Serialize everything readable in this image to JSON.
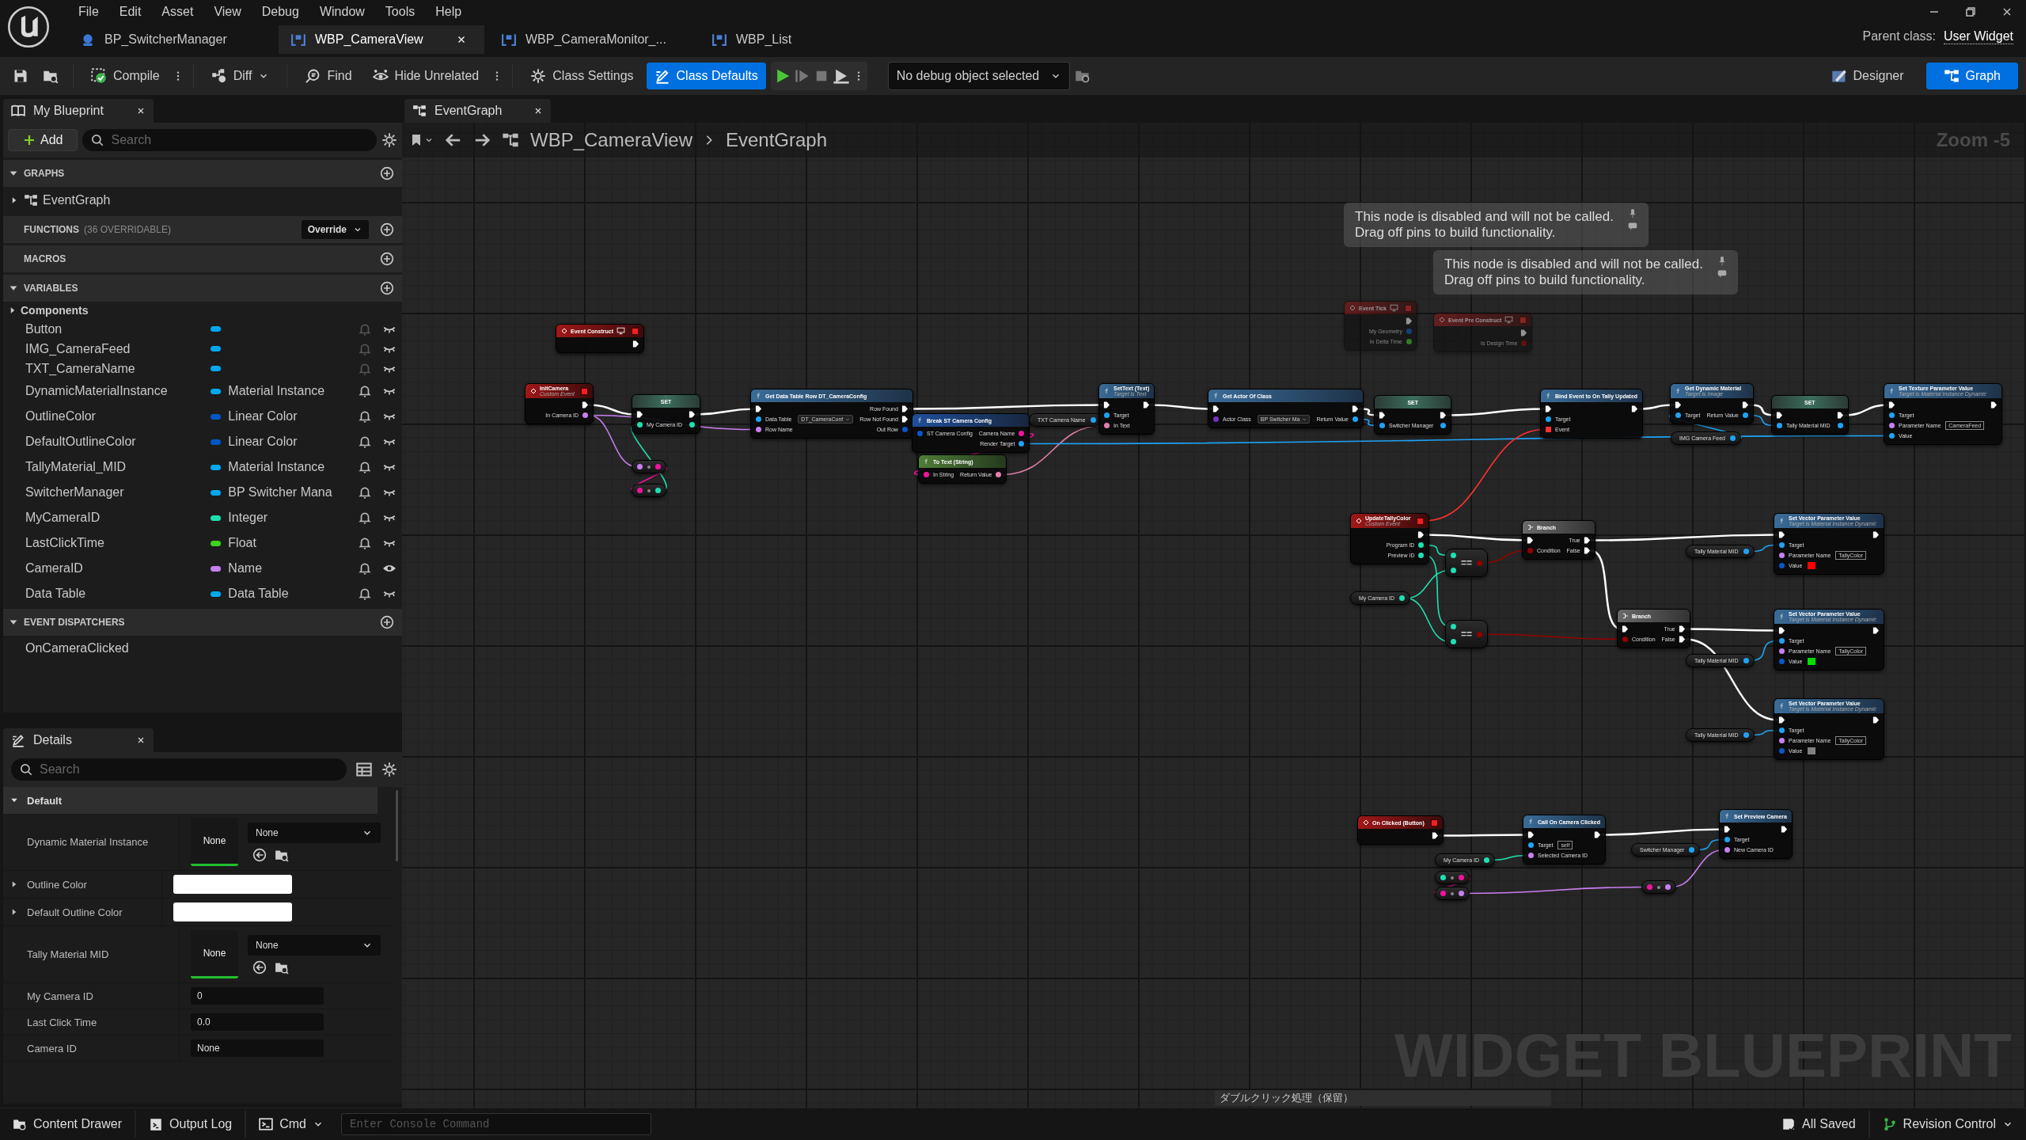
{
  "menu_bar": {
    "menus": [
      "File",
      "Edit",
      "Asset",
      "View",
      "Debug",
      "Window",
      "Tools",
      "Help"
    ]
  },
  "document_tabs": [
    {
      "label": "BP_SwitcherManager",
      "kind": "actor",
      "selected": false
    },
    {
      "label": "WBP_CameraView",
      "kind": "widget",
      "selected": true
    },
    {
      "label": "WBP_CameraMonitor_...",
      "kind": "widget",
      "selected": false
    },
    {
      "label": "WBP_List",
      "kind": "widget",
      "selected": false
    }
  ],
  "parent_class": {
    "label": "Parent class:",
    "value": "User Widget"
  },
  "toolbar": {
    "compile": "Compile",
    "diff": "Diff",
    "find": "Find",
    "hide_unrelated": "Hide Unrelated",
    "class_settings": "Class Settings",
    "class_defaults": {
      "label": "Class Defaults",
      "selected": true
    },
    "debug_object": "No debug object selected",
    "modes": [
      {
        "label": "Designer",
        "kind": "designer",
        "selected": false
      },
      {
        "label": "Graph",
        "kind": "graph",
        "selected": true
      }
    ]
  },
  "my_blueprint": {
    "tab": "My Blueprint",
    "add": "Add",
    "search_placeholder": "Search",
    "graphs": {
      "title": "GRAPHS",
      "expanded": true,
      "items": [
        {
          "label": "EventGraph",
          "expanded": false
        }
      ]
    },
    "functions": {
      "title": "FUNCTIONS",
      "note": "(36 OVERRIDABLE)",
      "override": "Override"
    },
    "macros": {
      "title": "MACROS"
    },
    "variables": {
      "title": "VARIABLES",
      "expanded": true,
      "category": {
        "label": "Components",
        "expanded": false
      },
      "items": [
        {
          "name": "Button",
          "color": "#00a8f0",
          "exposed": false
        },
        {
          "name": "IMG_CameraFeed",
          "color": "#00a8f0",
          "exposed": false
        },
        {
          "name": "TXT_CameraName",
          "color": "#00a8f0",
          "exposed": false
        },
        {
          "name": "DynamicMaterialInstance",
          "type": "Material Instance",
          "color": "#00a8f0",
          "exposed": false
        },
        {
          "name": "OutlineColor",
          "type": "Linear Color",
          "color": "#0058c8",
          "exposed": false
        },
        {
          "name": "DefaultOutlineColor",
          "type": "Linear Color",
          "color": "#0058c8",
          "exposed": false
        },
        {
          "name": "TallyMaterial_MID",
          "type": "Material Instance",
          "color": "#00a8f0",
          "exposed": false
        },
        {
          "name": "SwitcherManager",
          "type": "BP Switcher Mana",
          "color": "#00a8f0",
          "exposed": false
        },
        {
          "name": "MyCameraID",
          "type": "Integer",
          "color": "#1ee0b0",
          "exposed": false
        },
        {
          "name": "LastClickTime",
          "type": "Float",
          "color": "#3cd41e",
          "exposed": false
        },
        {
          "name": "CameraID",
          "type": "Name",
          "color": "#c880f0",
          "exposed": true
        },
        {
          "name": "Data Table",
          "type": "Data Table",
          "color": "#00a8f0",
          "exposed": false
        }
      ]
    },
    "event_dispatchers": {
      "title": "EVENT DISPATCHERS",
      "expanded": true,
      "items": [
        {
          "label": "OnCameraClicked"
        }
      ]
    }
  },
  "details": {
    "tab": "Details",
    "search_placeholder": "Search",
    "category": {
      "label": "Default",
      "expanded": true
    },
    "rows": [
      {
        "kind": "object",
        "label": "Dynamic Material Instance",
        "thumbnail": "None",
        "value": "None"
      },
      {
        "kind": "color",
        "label": "Outline Color",
        "expanded": false
      },
      {
        "kind": "color",
        "label": "Default Outline Color",
        "expanded": false
      },
      {
        "kind": "object",
        "label": "Tally Material MID",
        "thumbnail": "None",
        "value": "None"
      },
      {
        "kind": "field",
        "label": "My Camera ID",
        "value": "0"
      },
      {
        "kind": "field",
        "label": "Last Click Time",
        "value": "0.0"
      },
      {
        "kind": "field",
        "label": "Camera ID",
        "value": "None"
      }
    ]
  },
  "graph": {
    "tab": "EventGraph",
    "breadcrumb": [
      "WBP_CameraView",
      "EventGraph"
    ],
    "zoom": "Zoom -5",
    "watermark": "WIDGET BLUEPRINT",
    "comment": "ダブルクリック処理（保留）",
    "disabled_notes": [
      {
        "text": "This node is disabled and will not be called.\nDrag off pins to build functionality."
      },
      {
        "text": "This node is disabled and will not be called.\nDrag off pins to build functionality."
      }
    ],
    "nodes": [
      {
        "kind": "event",
        "title": "Event Construct",
        "override": true,
        "disabled": false,
        "outputs": [
          {
            "kind": "exec"
          }
        ]
      },
      {
        "kind": "event",
        "title": "InitCamera",
        "subtitle": "Custom Event",
        "override": false,
        "disabled": false,
        "outputs": [
          {
            "kind": "exec"
          },
          {
            "label": "In Camera ID",
            "kind": "name"
          }
        ]
      },
      {
        "kind": "set",
        "title": "SET",
        "disabled": false,
        "inputs": [
          {
            "kind": "exec"
          },
          {
            "label": "My Camera ID",
            "kind": "int"
          }
        ],
        "outputs": [
          {
            "kind": "exec"
          },
          {
            "kind": "int"
          }
        ]
      },
      {
        "kind": "function",
        "title": "Get Data Table Row DT_CameraConfig",
        "disabled": false,
        "inputs": [
          {
            "kind": "exec"
          },
          {
            "label": "Data Table",
            "kind": "object",
            "dropdown": "DT_CameraConf"
          },
          {
            "label": "Row Name",
            "kind": "name"
          }
        ],
        "outputs": [
          {
            "label": "Row Found",
            "kind": "exec"
          },
          {
            "label": "Row Not Found",
            "kind": "exec"
          },
          {
            "label": "Out Row",
            "kind": "struct"
          }
        ]
      },
      {
        "kind": "struct",
        "title": "Break ST Camera Config",
        "disabled": false,
        "inputs": [
          {
            "label": "ST Camera Config",
            "kind": "struct"
          }
        ],
        "outputs": [
          {
            "label": "Camera Name",
            "kind": "string"
          },
          {
            "label": "Render Target",
            "kind": "object"
          }
        ]
      },
      {
        "kind": "pure",
        "title": "To Text (String)",
        "disabled": false,
        "inputs": [
          {
            "label": "In String",
            "kind": "string"
          }
        ],
        "outputs": [
          {
            "label": "Return Value",
            "kind": "text"
          }
        ]
      },
      {
        "kind": "variable",
        "title": "TXT Camera Name",
        "disabled": false,
        "outputs": [
          {
            "kind": "object"
          }
        ]
      },
      {
        "kind": "function",
        "title": "SetText (Text)",
        "subtitle": "Target is Text",
        "disabled": false,
        "inputs": [
          {
            "kind": "exec"
          },
          {
            "label": "Target",
            "kind": "object"
          },
          {
            "label": "In Text",
            "kind": "text"
          }
        ],
        "outputs": [
          {
            "kind": "exec"
          }
        ]
      },
      {
        "kind": "function",
        "title": "Get Actor Of Class",
        "disabled": false,
        "inputs": [
          {
            "kind": "exec"
          },
          {
            "label": "Actor Class",
            "kind": "class",
            "dropdown": "BP Switcher Ma"
          }
        ],
        "outputs": [
          {
            "kind": "exec"
          },
          {
            "label": "Return Value",
            "kind": "object"
          }
        ]
      },
      {
        "kind": "compact",
        "disabled": false,
        "inputs": [
          {
            "kind": "name"
          }
        ],
        "outputs": [
          {
            "kind": "string"
          }
        ]
      },
      {
        "kind": "compact",
        "disabled": false,
        "inputs": [
          {
            "kind": "string"
          }
        ],
        "outputs": [
          {
            "kind": "int"
          }
        ]
      },
      {
        "kind": "event",
        "title": "Event Tick",
        "override": true,
        "disabled": true,
        "outputs": [
          {
            "kind": "exec"
          },
          {
            "label": "My Geometry",
            "kind": "struct"
          },
          {
            "label": "In Delta Time",
            "kind": "float"
          }
        ]
      },
      {
        "kind": "event",
        "title": "Event Pre Construct",
        "override": true,
        "disabled": true,
        "outputs": [
          {
            "kind": "exec"
          },
          {
            "label": "Is Design Time",
            "kind": "bool"
          }
        ]
      },
      {
        "kind": "set",
        "title": "SET",
        "disabled": false,
        "inputs": [
          {
            "kind": "exec"
          },
          {
            "label": "Switcher Manager",
            "kind": "object"
          }
        ],
        "outputs": [
          {
            "kind": "exec"
          },
          {
            "kind": "object"
          }
        ]
      },
      {
        "kind": "function",
        "title": "Bind Event to On Tally Updated",
        "disabled": false,
        "inputs": [
          {
            "kind": "exec"
          },
          {
            "label": "Target",
            "kind": "object"
          },
          {
            "label": "Event",
            "kind": "delegate"
          }
        ],
        "outputs": [
          {
            "kind": "exec"
          }
        ]
      },
      {
        "kind": "function",
        "title": "Get Dynamic Material",
        "subtitle": "Target is Image",
        "disabled": false,
        "inputs": [
          {
            "kind": "exec"
          },
          {
            "label": "Target",
            "kind": "object"
          }
        ],
        "outputs": [
          {
            "kind": "exec"
          },
          {
            "label": "Return Value",
            "kind": "object"
          }
        ]
      },
      {
        "kind": "variable",
        "title": "IMG Camera Feed",
        "disabled": false,
        "outputs": [
          {
            "kind": "object"
          }
        ]
      },
      {
        "kind": "set",
        "title": "SET",
        "disabled": false,
        "inputs": [
          {
            "kind": "exec"
          },
          {
            "label": "Tally Material MID",
            "kind": "object"
          }
        ],
        "outputs": [
          {
            "kind": "exec"
          },
          {
            "kind": "object"
          }
        ]
      },
      {
        "kind": "function",
        "title": "Set Texture Parameter Value",
        "subtitle": "Target is Material Instance Dynamic",
        "disabled": false,
        "inputs": [
          {
            "kind": "exec"
          },
          {
            "label": "Target",
            "kind": "object"
          },
          {
            "label": "Parameter Name",
            "kind": "name",
            "field": "CameraFeed"
          },
          {
            "label": "Value",
            "kind": "object"
          }
        ],
        "outputs": [
          {
            "kind": "exec"
          }
        ]
      },
      {
        "kind": "event",
        "title": "UpdateTallyColor",
        "subtitle": "Custom Event",
        "override": false,
        "disabled": false,
        "outputs": [
          {
            "kind": "exec"
          },
          {
            "label": "Program ID",
            "kind": "int"
          },
          {
            "label": "Preview ID",
            "kind": "int"
          }
        ]
      },
      {
        "kind": "variable",
        "title": "My Camera ID",
        "disabled": false,
        "outputs": [
          {
            "kind": "int"
          }
        ]
      },
      {
        "kind": "compact",
        "title": "==",
        "disabled": false,
        "inputs": [
          {
            "kind": "int"
          },
          {
            "kind": "int"
          }
        ],
        "outputs": [
          {
            "kind": "bool"
          }
        ]
      },
      {
        "kind": "compact",
        "title": "==",
        "disabled": false,
        "inputs": [
          {
            "kind": "int"
          },
          {
            "kind": "int"
          }
        ],
        "outputs": [
          {
            "kind": "bool"
          }
        ]
      },
      {
        "kind": "branch",
        "title": "Branch",
        "disabled": false,
        "inputs": [
          {
            "kind": "exec"
          },
          {
            "label": "Condition",
            "kind": "bool"
          }
        ],
        "outputs": [
          {
            "label": "True",
            "kind": "exec"
          },
          {
            "label": "False",
            "kind": "exec"
          }
        ]
      },
      {
        "kind": "branch",
        "title": "Branch",
        "disabled": false,
        "inputs": [
          {
            "kind": "exec"
          },
          {
            "label": "Condition",
            "kind": "bool"
          }
        ],
        "outputs": [
          {
            "label": "True",
            "kind": "exec"
          },
          {
            "label": "False",
            "kind": "exec"
          }
        ]
      },
      {
        "kind": "variable",
        "title": "Tally Material MID",
        "disabled": false,
        "outputs": [
          {
            "kind": "object"
          }
        ]
      },
      {
        "kind": "function",
        "title": "Set Vector Parameter Value",
        "subtitle": "Target is Material Instance Dynamic",
        "disabled": false,
        "inputs": [
          {
            "kind": "exec"
          },
          {
            "label": "Target",
            "kind": "object"
          },
          {
            "label": "Parameter Name",
            "kind": "name",
            "field": "TallyColor"
          },
          {
            "label": "Value",
            "kind": "struct",
            "color": "#ff0000"
          }
        ],
        "outputs": [
          {
            "kind": "exec"
          }
        ]
      },
      {
        "kind": "variable",
        "title": "Tally Material MID",
        "disabled": false,
        "outputs": [
          {
            "kind": "object"
          }
        ]
      },
      {
        "kind": "function",
        "title": "Set Vector Parameter Value",
        "subtitle": "Target is Material Instance Dynamic",
        "disabled": false,
        "inputs": [
          {
            "kind": "exec"
          },
          {
            "label": "Target",
            "kind": "object"
          },
          {
            "label": "Parameter Name",
            "kind": "name",
            "field": "TallyColor"
          },
          {
            "label": "Value",
            "kind": "struct",
            "color": "#00e000"
          }
        ],
        "outputs": [
          {
            "kind": "exec"
          }
        ]
      },
      {
        "kind": "variable",
        "title": "Tally Material MID",
        "disabled": false,
        "outputs": [
          {
            "kind": "object"
          }
        ]
      },
      {
        "kind": "function",
        "title": "Set Vector Parameter Value",
        "subtitle": "Target is Material Instance Dynamic",
        "disabled": false,
        "inputs": [
          {
            "kind": "exec"
          },
          {
            "label": "Target",
            "kind": "object"
          },
          {
            "label": "Parameter Name",
            "kind": "name",
            "field": "TallyColor"
          },
          {
            "label": "Value",
            "kind": "struct",
            "color": "#808080"
          }
        ],
        "outputs": [
          {
            "kind": "exec"
          }
        ]
      },
      {
        "kind": "event",
        "title": "On Clicked (Button)",
        "override": false,
        "disabled": false,
        "outputs": [
          {
            "kind": "exec"
          }
        ]
      },
      {
        "kind": "variable",
        "title": "My Camera ID",
        "disabled": false,
        "outputs": [
          {
            "kind": "int"
          }
        ]
      },
      {
        "kind": "compact",
        "disabled": false,
        "inputs": [
          {
            "kind": "int"
          }
        ],
        "outputs": [
          {
            "kind": "string"
          }
        ]
      },
      {
        "kind": "compact",
        "disabled": false,
        "inputs": [
          {
            "kind": "string"
          }
        ],
        "outputs": [
          {
            "kind": "name"
          }
        ]
      },
      {
        "kind": "function",
        "title": "Call On Camera Clicked",
        "disabled": false,
        "inputs": [
          {
            "kind": "exec"
          },
          {
            "label": "Target",
            "kind": "object",
            "field": "self"
          },
          {
            "label": "Selected Camera ID",
            "kind": "name"
          }
        ],
        "outputs": [
          {
            "kind": "exec"
          }
        ]
      },
      {
        "kind": "variable",
        "title": "Switcher Manager",
        "disabled": false,
        "outputs": [
          {
            "kind": "object"
          }
        ]
      },
      {
        "kind": "compact",
        "disabled": false,
        "inputs": [
          {
            "kind": "string"
          }
        ],
        "outputs": [
          {
            "kind": "name"
          }
        ]
      },
      {
        "kind": "function",
        "title": "Set Preview Camera",
        "disabled": false,
        "inputs": [
          {
            "kind": "exec"
          },
          {
            "label": "Target",
            "kind": "object"
          },
          {
            "label": "New Camera ID",
            "kind": "name"
          }
        ],
        "outputs": [
          {
            "kind": "exec"
          }
        ]
      }
    ]
  },
  "status_bar": {
    "content_drawer": "Content Drawer",
    "output_log": "Output Log",
    "cmd": "Cmd",
    "console_placeholder": "Enter Console Command",
    "save_state": "All Saved",
    "revision_control": "Revision Control"
  }
}
